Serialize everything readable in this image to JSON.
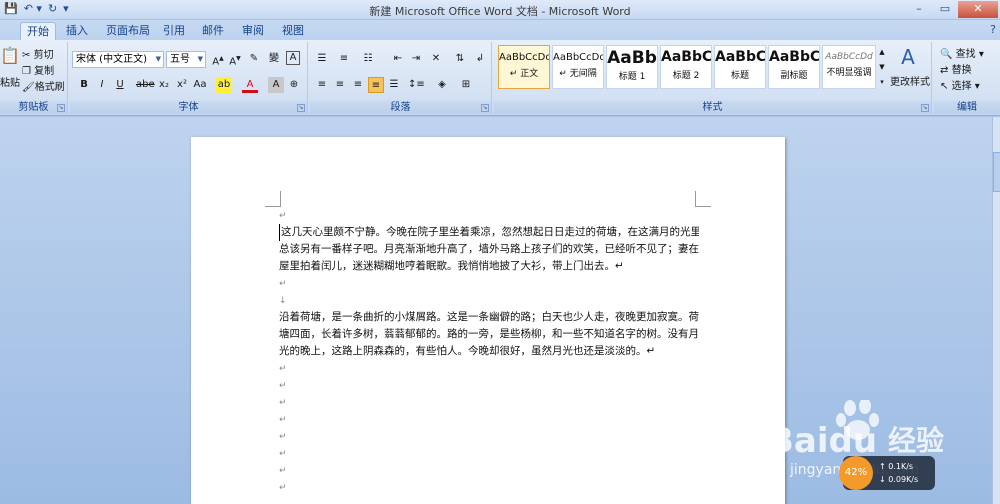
{
  "window": {
    "title": "新建 Microsoft Office Word 文档 - Microsoft Word",
    "minimize": "–",
    "maximize": "▭",
    "close": "✕"
  },
  "tabs": [
    "开始",
    "插入",
    "页面布局",
    "引用",
    "邮件",
    "审阅",
    "视图"
  ],
  "clipboard": {
    "paste": "粘贴",
    "cut": "剪切",
    "copy": "复制",
    "format_painter": "格式刷",
    "label": "剪贴板"
  },
  "font": {
    "name": "宋体 (中文正文)",
    "size": "五号",
    "label": "字体"
  },
  "paragraph": {
    "label": "段落"
  },
  "styles": {
    "label": "样式",
    "change": "更改样式",
    "items": [
      {
        "sample": "AaBbCcDd",
        "name": "↵ 正文"
      },
      {
        "sample": "AaBbCcDd",
        "name": "↵ 无间隔"
      },
      {
        "sample": "AaBb",
        "name": "标题 1"
      },
      {
        "sample": "AaBbC",
        "name": "标题 2"
      },
      {
        "sample": "AaBbC",
        "name": "标题"
      },
      {
        "sample": "AaBbC",
        "name": "副标题"
      },
      {
        "sample": "AaBbCcDd",
        "name": "不明显强调"
      }
    ]
  },
  "editing": {
    "find": "查找",
    "replace": "替换",
    "select": "选择",
    "label": "编辑"
  },
  "document": {
    "lines": [
      "↵",
      "这几天心里颇不宁静。今晚在院子里坐着乘凉，忽然想起日日走过的荷塘，在这满月的光里，",
      "总该另有一番样子吧。月亮渐渐地升高了，墙外马路上孩子们的欢笑，已经听不见了；妻在",
      "屋里拍着闰儿，迷迷糊糊地哼着眠歌。我悄悄地披了大衫，带上门出去。↵",
      "↵",
      "↓",
      "沿着荷塘，是一条曲折的小煤屑路。这是一条幽僻的路；白天也少人走，夜晚更加寂寞。荷",
      "塘四面，长着许多树，蓊蓊郁郁的。路的一旁，是些杨柳，和一些不知道名字的树。没有月",
      "光的晚上，这路上阴森森的，有些怕人。今晚却很好，虽然月光也还是淡淡的。↵",
      "↵",
      "↵",
      "↵",
      "↵",
      "↵",
      "↵",
      "↵",
      "↵"
    ]
  },
  "watermark": {
    "brand": "Baidu",
    "brand_cn": "经验",
    "url": "jingyan.baidu.com"
  },
  "speed_widget": {
    "percent": "42%",
    "up": "0.1K/s",
    "down": "0.09K/s"
  }
}
